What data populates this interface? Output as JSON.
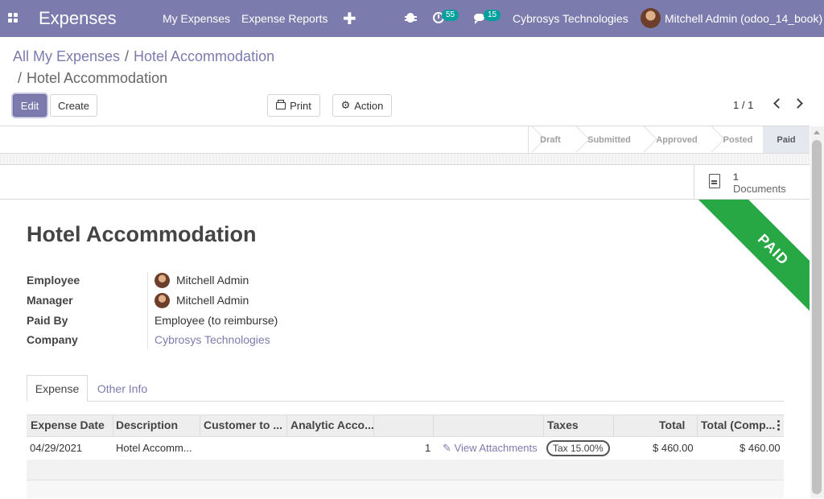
{
  "navbar": {
    "app_title": "Expenses",
    "menu": [
      "My Expenses",
      "Expense Reports"
    ],
    "activity_count": "55",
    "message_count": "15",
    "company": "Cybrosys Technologies",
    "user": "Mitchell Admin (odoo_14_book)"
  },
  "breadcrumb": {
    "parent": "All My Expenses",
    "separator": "/",
    "middle": "Hotel Accommodation",
    "current": "Hotel Accommodation"
  },
  "toolbar": {
    "edit_label": "Edit",
    "create_label": "Create",
    "print_label": "Print",
    "action_label": "Action",
    "pager": "1 / 1"
  },
  "statusbar": {
    "steps": [
      "Draft",
      "Submitted",
      "Approved",
      "Posted",
      "Paid"
    ],
    "active": "Paid"
  },
  "documents": {
    "count": "1",
    "label": "Documents"
  },
  "ribbon": "PAID",
  "record": {
    "title": "Hotel Accommodation",
    "fields": [
      {
        "label": "Employee",
        "value": "Mitchell Admin"
      },
      {
        "label": "Manager",
        "value": "Mitchell Admin"
      },
      {
        "label": "Paid By",
        "value": "Employee (to reimburse)"
      },
      {
        "label": "Company",
        "value": "Cybrosys Technologies"
      }
    ]
  },
  "tabs": [
    "Expense",
    "Other Info"
  ],
  "table": {
    "headers": [
      "Expense Date",
      "Description",
      "Customer to ...",
      "Analytic Acco...",
      "",
      "",
      "Taxes",
      "Total",
      "Total (Comp..."
    ],
    "rows": [
      {
        "date": "04/29/2021",
        "description": "Hotel Accomm...",
        "quantity": "1",
        "attachments": "View Attachments",
        "tax": "Tax 15.00%",
        "total": "$ 460.00",
        "total_company": "$ 460.00"
      }
    ]
  },
  "colors": {
    "brand": "#7c7bad",
    "ribbon": "#28a745"
  }
}
